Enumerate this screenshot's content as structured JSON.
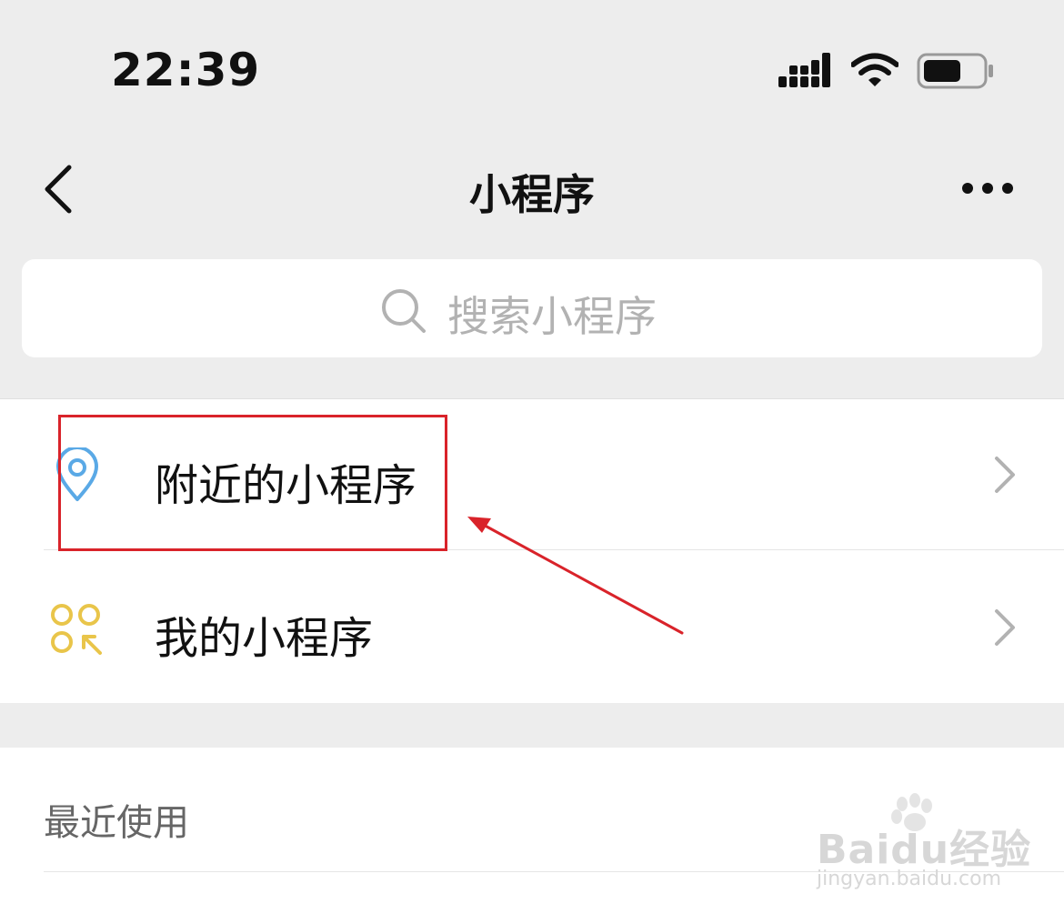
{
  "status_bar": {
    "time": "22:39",
    "signal_icon": "cellular-signal-icon",
    "wifi_icon": "wifi-icon",
    "battery_icon": "battery-icon"
  },
  "nav": {
    "title": "小程序",
    "back_icon": "chevron-left-icon",
    "more_icon": "ellipsis-icon"
  },
  "search": {
    "placeholder": "搜索小程序",
    "icon": "search-icon"
  },
  "menu": {
    "items": [
      {
        "label": "附近的小程序",
        "icon": "location-pin-icon",
        "icon_color": "#5aa9e6"
      },
      {
        "label": "我的小程序",
        "icon": "my-apps-icon",
        "icon_color": "#e9c54a"
      }
    ]
  },
  "recent": {
    "label": "最近使用"
  },
  "annotation": {
    "color": "#d9232a"
  },
  "watermark": {
    "brand": "Baidu经验",
    "url": "jingyan.baidu.com"
  }
}
